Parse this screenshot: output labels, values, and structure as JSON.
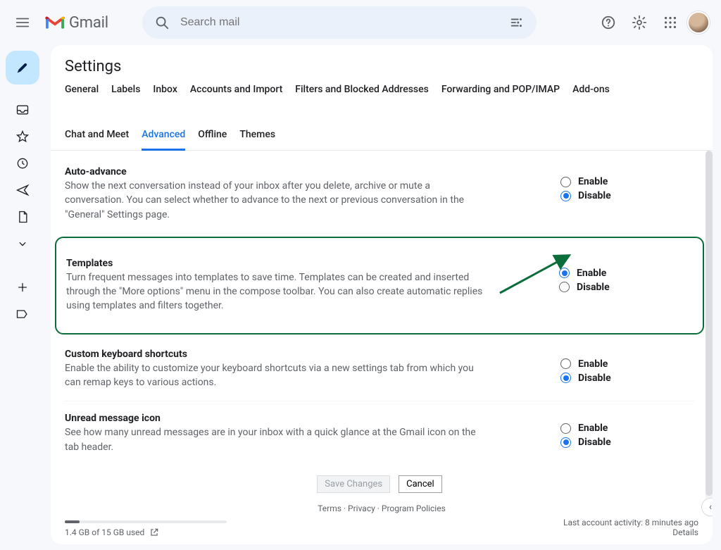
{
  "app": {
    "name": "Gmail"
  },
  "search": {
    "placeholder": "Search mail"
  },
  "page_title": "Settings",
  "tabs": {
    "row1": [
      "General",
      "Labels",
      "Inbox",
      "Accounts and Import",
      "Filters and Blocked Addresses",
      "Forwarding and POP/IMAP",
      "Add-ons"
    ],
    "row2": [
      "Chat and Meet",
      "Advanced",
      "Offline",
      "Themes"
    ],
    "active": "Advanced"
  },
  "options": {
    "enable": "Enable",
    "disable": "Disable"
  },
  "settings": [
    {
      "key": "auto_advance",
      "title": "Auto-advance",
      "desc": "Show the next conversation instead of your inbox after you delete, archive or mute a conversation. You can select whether to advance to the next or previous conversation in the \"General\" Settings page.",
      "selected": "disable",
      "highlighted": false
    },
    {
      "key": "templates",
      "title": "Templates",
      "desc": "Turn frequent messages into templates to save time. Templates can be created and inserted through the \"More options\" menu in the compose toolbar. You can also create automatic replies using templates and filters together.",
      "selected": "enable",
      "highlighted": true
    },
    {
      "key": "custom_shortcuts",
      "title": "Custom keyboard shortcuts",
      "desc": "Enable the ability to customize your keyboard shortcuts via a new settings tab from which you can remap keys to various actions.",
      "selected": "disable",
      "highlighted": false
    },
    {
      "key": "unread_icon",
      "title": "Unread message icon",
      "desc": "See how many unread messages are in your inbox with a quick glance at the Gmail icon on the tab header.",
      "selected": "disable",
      "highlighted": false
    }
  ],
  "buttons": {
    "save": "Save Changes",
    "cancel": "Cancel"
  },
  "footer": {
    "links": [
      "Terms",
      "Privacy",
      "Program Policies"
    ],
    "activity": "Last account activity: 8 minutes ago",
    "details": "Details",
    "storage": "1.4 GB of 15 GB used"
  },
  "annotation": {
    "kind": "arrow",
    "target": "templates enable radio"
  }
}
